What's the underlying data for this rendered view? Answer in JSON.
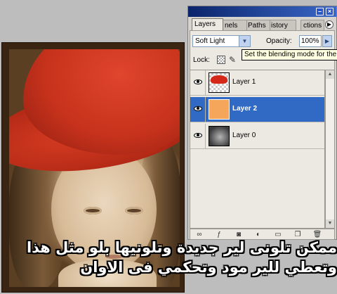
{
  "palette": {
    "tabs": [
      "Layers",
      "Channels",
      "Paths",
      "History",
      "Actions"
    ],
    "tab_visible": [
      "Layers",
      "nels",
      "Paths",
      "istory",
      "ctions"
    ],
    "blend_mode": "Soft Light",
    "opacity_label": "Opacity:",
    "opacity_value": "100%",
    "lock_label": "Lock:",
    "tooltip": "Set the blending mode for the",
    "layers": [
      {
        "name": "Layer 1",
        "selected": false
      },
      {
        "name": "Layer 2",
        "selected": true
      },
      {
        "name": "Layer 0",
        "selected": false
      }
    ],
    "colors": {
      "selection": "#316ac5",
      "layer2_fill": "#f6a65a",
      "title_bar": "#0a246a"
    }
  },
  "caption": {
    "line1": "ممكن تلونى لير جديدة وتلونيها بلو مثل هذا",
    "line2": "وتعطي للير مود وتحكمي فى الاوان"
  }
}
